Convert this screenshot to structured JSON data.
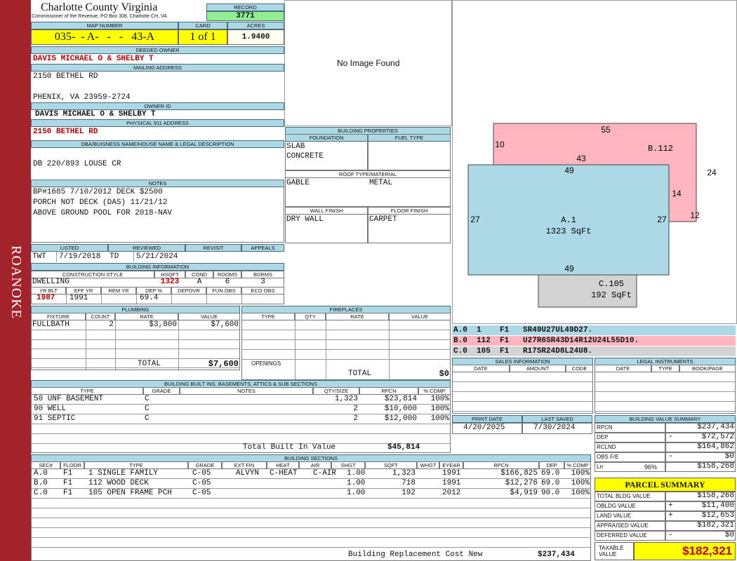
{
  "side_banner": "ROANOKE",
  "county": "Charlotte County Virginia",
  "county_sub": "Commissioner of the Revenue, PO Box 308, Charlotte CH, VA",
  "record": {
    "label": "RECORD",
    "value": "3771"
  },
  "map_number": {
    "label": "MAP NUMBER",
    "value": "035-  - A-   -   -   43-A"
  },
  "card": {
    "label": "CARD",
    "value": "1 of 1"
  },
  "acres": {
    "label": "ACRES",
    "value": "1.9400"
  },
  "deeded_owner": {
    "label": "DEEDED OWNER",
    "value": "DAVIS MICHAEL O & SHELBY T"
  },
  "mailing": {
    "label": "MAILING ADDRESS",
    "line1": "2150 BETHEL RD",
    "line2": "PHENIX, VA 23959-2724"
  },
  "owner_id": {
    "label": "OWNER ID",
    "value": "DAVIS MICHAEL O & SHELBY T"
  },
  "physical": {
    "label": "PHYSICAL 911 ADDRESS",
    "value": "2150 BETHEL RD"
  },
  "dba": {
    "label": "DBA/BUISNESS NAME/HOUSE NAME & LEGAL DESCRIPTION",
    "value": "DB 220/893 LOUSE CR"
  },
  "notes": {
    "label": "NOTES",
    "lines": [
      "BP#1685 7/10/2012 DECK $2500",
      "PORCH NOT DECK (DAS) 11/21/12",
      "ABOVE GROUND POOL FOR 2018-NAV"
    ]
  },
  "photo": {
    "text": "No Image Found"
  },
  "building_props": {
    "label": "BUILDING PROPERTIES",
    "foundation_label": "FOUNDATION",
    "fuel_label": "FUEL TYPE",
    "foundation": [
      "SLAB",
      "CONCRETE"
    ],
    "fuel": "",
    "roof_label": "ROOF TYPE/MATERIAL",
    "roof_type": "GABLE",
    "roof_material": "METAL",
    "wall_label": "WALL FINISH",
    "floor_label": "FLOOR FINISH",
    "wall": "DRY WALL",
    "floor": "CARPET"
  },
  "listed": {
    "listed_label": "LISTED",
    "reviewed_label": "REVIEWED",
    "revisit_label": "REVISIT",
    "appeals_label": "APPEALS",
    "listed_by": "TWT",
    "listed_date": "7/19/2018",
    "reviewed_by": "TD",
    "reviewed_date": "5/21/2024"
  },
  "building_info": {
    "label": "BUILDING INFORMATION",
    "h1": [
      "CONSTRUCTION STYLE",
      "HSQFT",
      "COND",
      "ROOMS",
      "BDRMS"
    ],
    "v1": [
      "DWELLING",
      "1323",
      "A",
      "6",
      "3"
    ],
    "h2": [
      "YR BLT",
      "EFF YR",
      "REM YR",
      "DEP %",
      "DEPOVR",
      "FUN OBS",
      "ECO OBS"
    ],
    "v2": [
      "1987",
      "1991",
      "",
      "69.4",
      "",
      "",
      ""
    ]
  },
  "plumbing": {
    "label": "PLUMBING",
    "headers": [
      "FIXTURE",
      "COUNT",
      "RATE",
      "VALUE"
    ],
    "rows": [
      [
        "FULLBATH",
        "2",
        "$3,800",
        "$7,600"
      ]
    ],
    "total_label": "TOTAL",
    "total": "$7,600"
  },
  "fireplaces": {
    "label": "FIREPLACES",
    "headers": [
      "TYPE",
      "QTY",
      "RATE",
      "VALUE"
    ],
    "openings_label": "OPENINGS",
    "total_label": "TOTAL",
    "total": "$0"
  },
  "builtins": {
    "label": "BUILDING BUILT INS, BASEMENTS, ATTICS & SUB SECTIONS",
    "headers": [
      "TYPE",
      "GRADE",
      "NOTES",
      "QTY/SIZE",
      "RPCN",
      "% COMP"
    ],
    "rows": [
      [
        "50 UNF BASEMENT",
        "C",
        "",
        "1,323",
        "$23,814",
        "100%"
      ],
      [
        "90 WELL",
        "C",
        "",
        "2",
        "$10,000",
        "100%"
      ],
      [
        "91 SEPTIC",
        "C",
        "",
        "2",
        "$12,000",
        "100%"
      ]
    ],
    "total_label": "Total Built In Value",
    "total": "$45,814"
  },
  "sections": {
    "label": "BUILDING SECTIONS",
    "headers": [
      "SEC#",
      "FLOOR",
      "TYPE",
      "GRADE",
      "EXT FIN",
      "HEAT",
      "AIR",
      "SHGT",
      "SQFT",
      "WHGT",
      "EYEAR",
      "RPCN",
      "DEP",
      "% COMP"
    ],
    "rows": [
      [
        "A.0",
        "F1",
        "1 SINGLE FAMILY",
        "C-05",
        "ALVYN",
        "C-HEAT",
        "C-AIR",
        "1.00",
        "1,323",
        "",
        "1991",
        "$166,825",
        "69.0",
        "100%"
      ],
      [
        "B.0",
        "F1",
        "112 WOOD DECK",
        "C-05",
        "",
        "",
        "",
        "1.00",
        "718",
        "",
        "1991",
        "$12,276",
        "69.0",
        "100%"
      ],
      [
        "C.0",
        "F1",
        "105 OPEN FRAME PCH",
        "C-05",
        "",
        "",
        "",
        "1.00",
        "192",
        "",
        "2012",
        "$4,919",
        "90.0",
        "100%"
      ]
    ],
    "rcn_label": "Building Replacement Cost New",
    "rcn": "$237,434"
  },
  "sketch": {
    "b_label": "B.112",
    "b_dims": [
      "55",
      "10",
      "43",
      "24",
      "14",
      "12"
    ],
    "a_label": "A.1",
    "a_area": "1323 SqFt",
    "a_dims": [
      "49",
      "27",
      "27",
      "49"
    ],
    "c_label": "C.105",
    "c_area": "192 SqFt",
    "a_color": "#add8e6",
    "b_color": "#ffb6c1",
    "c_color": "#d3d3d3"
  },
  "sketch_codes": [
    {
      "text": "A.0  1    F1   SR49U27UL49D27.",
      "color": "#add8e6"
    },
    {
      "text": "B.0  112  F1   U27R6SR43D14R12U24L55D10.",
      "color": "#ffb6c1"
    },
    {
      "text": "C.0  105  F1   R17SR24D8L24U8.",
      "color": "#d3d3d3"
    }
  ],
  "sales": {
    "label": "SALES INFORMATION",
    "headers": [
      "DATE",
      "AMOUNT",
      "CODE"
    ]
  },
  "legal": {
    "label": "LEGAL INSTRUMENTS",
    "headers": [
      "DATE",
      "TYPE",
      "BOOK/PAGE"
    ]
  },
  "print": {
    "print_label": "PRINT DATE",
    "print_date": "4/20/2025",
    "saved_label": "LAST SAVED",
    "saved_date": "7/30/2024"
  },
  "bvs": {
    "label": "BUILDING VALUE SUMMARY",
    "rows": [
      {
        "k": "RPCN",
        "sign": "",
        "v": "$237,434"
      },
      {
        "k": "DEP",
        "sign": "-",
        "v": "$72,572"
      },
      {
        "k": "RCLND",
        "sign": "",
        "v": "$164,862"
      },
      {
        "k": "OBS F/E",
        "sign": "-",
        "v": "$0"
      },
      {
        "k": "Lrr",
        "pct": "96%",
        "sign": "",
        "v": "$158,268"
      }
    ]
  },
  "parcel": {
    "label": "PARCEL SUMMARY",
    "rows": [
      {
        "k": "TOTAL BLDG VALUE",
        "sign": "",
        "v": "$158,268"
      },
      {
        "k": "OBLDG VALUE",
        "sign": "+",
        "v": "$11,400"
      },
      {
        "k": "LAND VALUE",
        "sign": "+",
        "v": "$12,653"
      },
      {
        "k": "APPRAISED VALUE",
        "sign": "",
        "v": "$182,321"
      },
      {
        "k": "DEFERRED VALUE",
        "sign": "-",
        "v": "$0"
      }
    ],
    "taxable_label": "TAXABLE VALUE",
    "taxable": "$182,321"
  }
}
